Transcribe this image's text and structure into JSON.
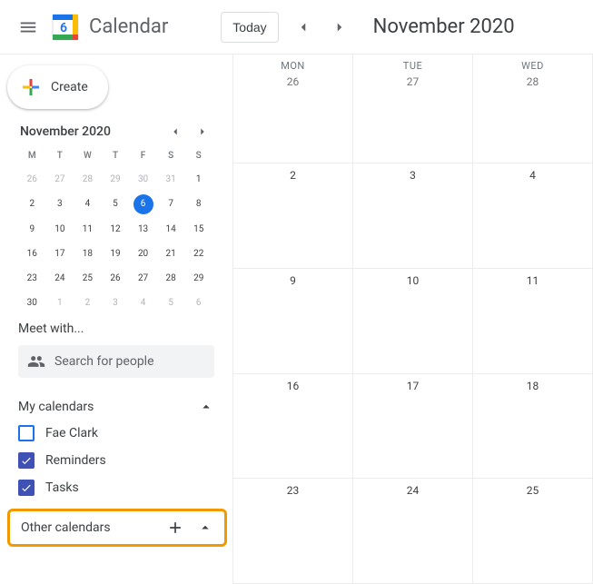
{
  "header": {
    "app_name": "Calendar",
    "logo_day": "6",
    "today_label": "Today",
    "month_label": "November 2020"
  },
  "create_label": "Create",
  "mini": {
    "title": "November 2020",
    "dow": [
      "M",
      "T",
      "W",
      "T",
      "F",
      "S",
      "S"
    ],
    "rows": [
      [
        {
          "n": 26,
          "dim": true
        },
        {
          "n": 27,
          "dim": true
        },
        {
          "n": 28,
          "dim": true
        },
        {
          "n": 29,
          "dim": true
        },
        {
          "n": 30,
          "dim": true
        },
        {
          "n": 31,
          "dim": true
        },
        {
          "n": 1
        }
      ],
      [
        {
          "n": 2
        },
        {
          "n": 3
        },
        {
          "n": 4
        },
        {
          "n": 5
        },
        {
          "n": 6,
          "sel": true
        },
        {
          "n": 7
        },
        {
          "n": 8
        }
      ],
      [
        {
          "n": 9
        },
        {
          "n": 10
        },
        {
          "n": 11
        },
        {
          "n": 12
        },
        {
          "n": 13
        },
        {
          "n": 14
        },
        {
          "n": 15
        }
      ],
      [
        {
          "n": 16
        },
        {
          "n": 17
        },
        {
          "n": 18
        },
        {
          "n": 19
        },
        {
          "n": 20
        },
        {
          "n": 21
        },
        {
          "n": 22
        }
      ],
      [
        {
          "n": 23
        },
        {
          "n": 24
        },
        {
          "n": 25
        },
        {
          "n": 26
        },
        {
          "n": 27
        },
        {
          "n": 28
        },
        {
          "n": 29
        }
      ],
      [
        {
          "n": 30
        },
        {
          "n": 1,
          "dim": true
        },
        {
          "n": 2,
          "dim": true
        },
        {
          "n": 3,
          "dim": true
        },
        {
          "n": 4,
          "dim": true
        },
        {
          "n": 5,
          "dim": true
        },
        {
          "n": 6,
          "dim": true
        }
      ]
    ]
  },
  "meet": {
    "title": "Meet with...",
    "placeholder": "Search for people"
  },
  "my_calendars": {
    "title": "My calendars",
    "items": [
      {
        "label": "Fae Clark",
        "checked": false,
        "color": "#1a73e8"
      },
      {
        "label": "Reminders",
        "checked": true,
        "color": "#3f51b5"
      },
      {
        "label": "Tasks",
        "checked": true,
        "color": "#3f51b5"
      }
    ]
  },
  "other_calendars": {
    "title": "Other calendars"
  },
  "big_grid": {
    "columns": [
      {
        "dow": "MON",
        "head_num": 26,
        "days": [
          2,
          9,
          16,
          23
        ]
      },
      {
        "dow": "TUE",
        "head_num": 27,
        "days": [
          3,
          10,
          17,
          24
        ]
      },
      {
        "dow": "WED",
        "head_num": 28,
        "days": [
          4,
          11,
          18,
          25
        ]
      }
    ]
  }
}
